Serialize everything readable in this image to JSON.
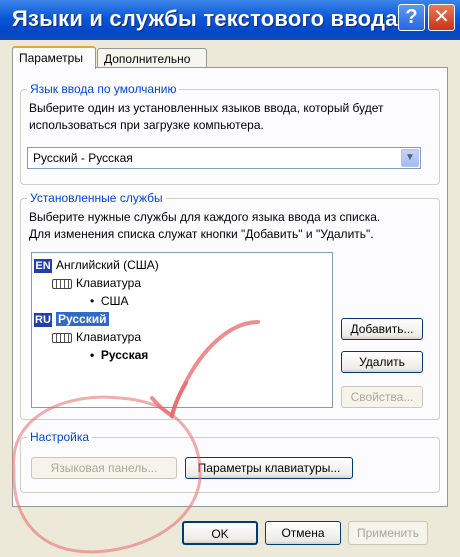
{
  "window": {
    "title": "Языки и службы текстового ввода",
    "help_glyph": "?",
    "close_glyph": "✕"
  },
  "tabs": [
    {
      "label": "Параметры",
      "active": true
    },
    {
      "label": "Дополнительно",
      "active": false
    }
  ],
  "default_lang": {
    "legend": "Язык ввода по умолчанию",
    "description_1": "Выберите один из установленных языков ввода, который будет",
    "description_2": "использоваться при загрузке компьютера.",
    "selected": "Русский - Русская",
    "dropdown_glyph": "▼"
  },
  "services": {
    "legend": "Установленные службы",
    "description_1": "Выберите нужные службы для каждого языка ввода из списка.",
    "description_2": "Для изменения списка служат кнопки \"Добавить\" и \"Удалить\".",
    "tree": {
      "lang1_code": "EN",
      "lang1_name": "Английский (США)",
      "lang1_service": "Клавиатура",
      "lang1_layout": "США",
      "lang2_code": "RU",
      "lang2_name": "Русский",
      "lang2_service": "Клавиатура",
      "lang2_layout": "Русская",
      "bullet": "•"
    },
    "add_button": "Добавить...",
    "remove_button": "Удалить",
    "properties_button": "Свойства..."
  },
  "settings": {
    "legend": "Настройка",
    "language_bar_button": "Языковая панель...",
    "keyboard_settings_button": "Параметры клавиатуры..."
  },
  "footer": {
    "ok_button": "OK",
    "cancel_button": "Отмена",
    "apply_button": "Применить"
  },
  "colors": {
    "titlebar": "#0a57d8",
    "legend_text": "#0046d5",
    "selection": "#316ac5",
    "annotation_stroke": "#e8676a"
  }
}
